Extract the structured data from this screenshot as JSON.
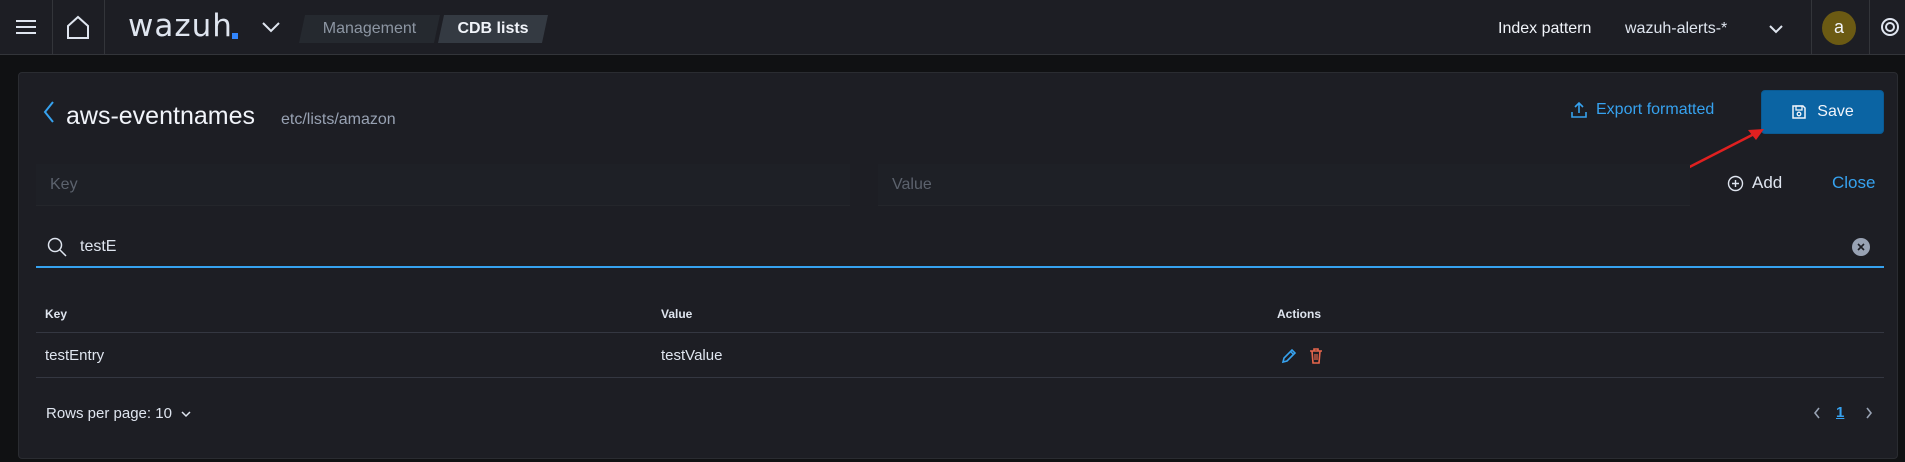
{
  "header": {
    "logo": "wazuh",
    "breadcrumbs": [
      "Management",
      "CDB lists"
    ],
    "index_pattern_label": "Index pattern",
    "index_pattern_value": "wazuh-alerts-*",
    "avatar_initial": "a",
    "accent_color": "#3185fc"
  },
  "list": {
    "title": "aws-eventnames",
    "path": "etc/lists/amazon",
    "export_label": "Export formatted",
    "save_label": "Save"
  },
  "form": {
    "key_placeholder": "Key",
    "value_placeholder": "Value",
    "add_label": "Add",
    "close_label": "Close"
  },
  "search": {
    "value": "testE"
  },
  "table": {
    "columns": [
      "Key",
      "Value",
      "Actions"
    ],
    "rows": [
      {
        "key": "testEntry",
        "value": "testValue"
      }
    ]
  },
  "pagination": {
    "rows_per_page": "Rows per page: 10",
    "current_page": "1"
  },
  "colors": {
    "link": "#36a2ef",
    "primary_button": "#0b64a3",
    "delete_icon": "#e7664c",
    "annotation_arrow": "#e02020"
  }
}
